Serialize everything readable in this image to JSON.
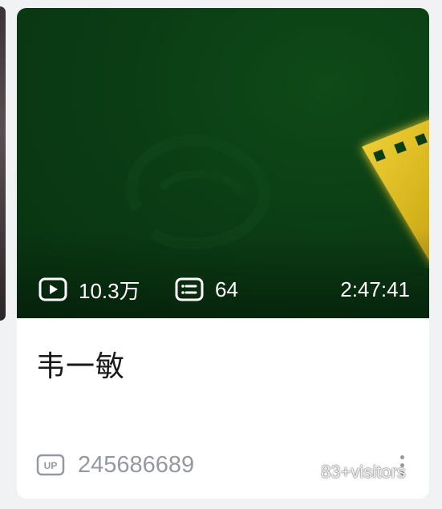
{
  "video_card": {
    "views": "10.3万",
    "danmaku_count": "64",
    "duration": "2:47:41",
    "title": "韦一敏",
    "uploader_badge": "UP",
    "uploader_name": "245686689"
  },
  "icons": {
    "views": "play-icon",
    "danmaku": "danmaku-icon",
    "uploader": "up-badge-icon",
    "more": "more-vertical-icon"
  },
  "colors": {
    "cover_background": "#0b3d14",
    "film_gold": "#d4b21c",
    "title": "#18191c",
    "secondary_text": "#9499a0"
  },
  "watermark": "83+visitors"
}
